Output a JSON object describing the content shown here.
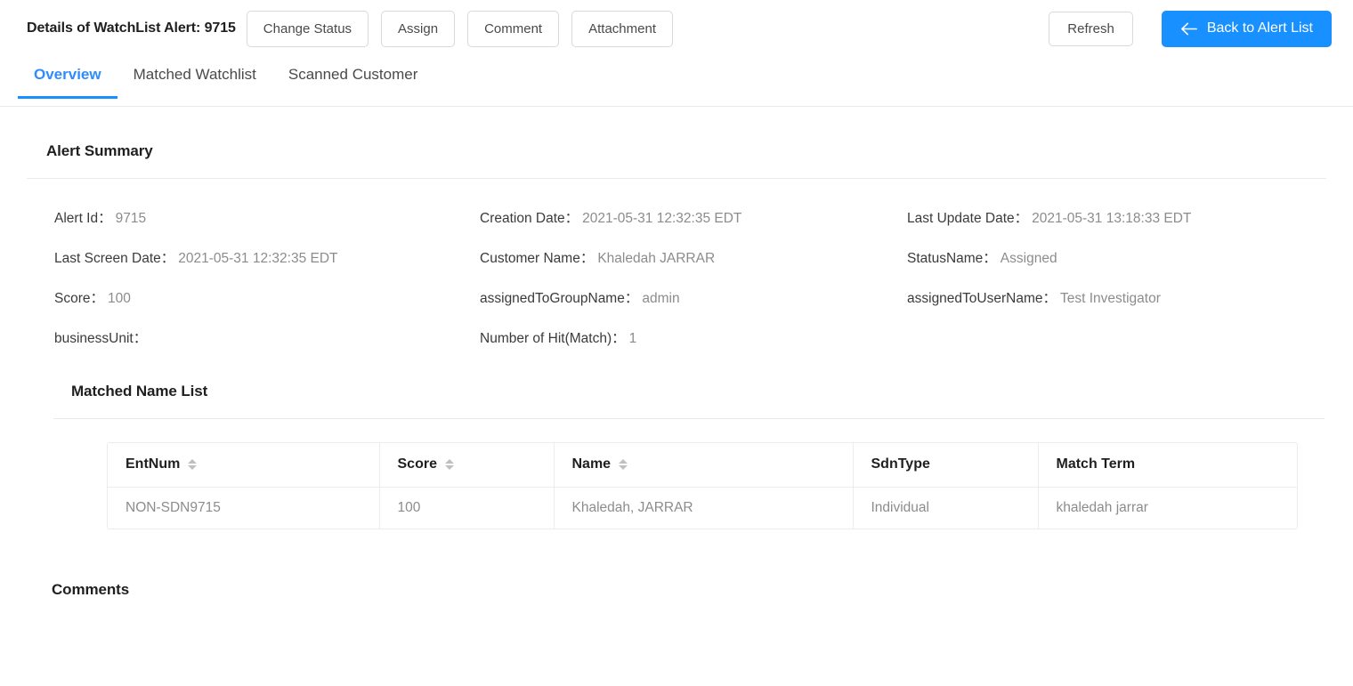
{
  "header": {
    "title": "Details of WatchList Alert: 9715",
    "actions": [
      {
        "name": "change-status-button",
        "label": "Change Status"
      },
      {
        "name": "assign-button",
        "label": "Assign"
      },
      {
        "name": "comment-button",
        "label": "Comment"
      },
      {
        "name": "attachment-button",
        "label": "Attachment"
      }
    ],
    "refresh_label": "Refresh",
    "back_label": "Back to Alert List",
    "back_icon": "arrow-left-icon"
  },
  "tabs": [
    {
      "label": "Overview",
      "active": true
    },
    {
      "label": "Matched Watchlist",
      "active": false
    },
    {
      "label": "Scanned Customer",
      "active": false
    }
  ],
  "alert_summary": {
    "section_title": "Alert Summary",
    "fields": [
      {
        "label": "Alert Id：",
        "value": "9715",
        "name": "field-alert-id"
      },
      {
        "label": "Creation Date：",
        "value": "2021-05-31 12:32:35 EDT",
        "name": "field-creation-date"
      },
      {
        "label": "Last Update Date：",
        "value": "2021-05-31 13:18:33 EDT",
        "name": "field-last-update-date"
      },
      {
        "label": "Last Screen Date：",
        "value": "2021-05-31 12:32:35 EDT",
        "name": "field-last-screen-date"
      },
      {
        "label": "Customer Name：",
        "value": "Khaledah JARRAR",
        "name": "field-customer-name"
      },
      {
        "label": "StatusName：",
        "value": "Assigned",
        "name": "field-status-name"
      },
      {
        "label": "Score：",
        "value": "100",
        "name": "field-score"
      },
      {
        "label": "assignedToGroupName：",
        "value": "admin",
        "name": "field-assigned-to-group-name"
      },
      {
        "label": "assignedToUserName：",
        "value": "Test Investigator",
        "name": "field-assigned-to-user-name"
      },
      {
        "label": "businessUnit：",
        "value": "",
        "name": "field-business-unit"
      },
      {
        "label": "Number of Hit(Match)：",
        "value": "1",
        "name": "field-number-of-hits"
      },
      {
        "label": "",
        "value": "",
        "name": "field-empty"
      }
    ]
  },
  "matched_name_list": {
    "section_title": "Matched Name List",
    "columns": [
      {
        "label": "EntNum",
        "sortable": true,
        "key": "entnum"
      },
      {
        "label": "Score",
        "sortable": true,
        "key": "score"
      },
      {
        "label": "Name",
        "sortable": true,
        "key": "name"
      },
      {
        "label": "SdnType",
        "sortable": false,
        "key": "sdntype"
      },
      {
        "label": "Match Term",
        "sortable": false,
        "key": "matchterm"
      }
    ],
    "rows": [
      {
        "entnum": "NON-SDN9715",
        "score": "100",
        "name": "Khaledah, JARRAR",
        "sdntype": "Individual",
        "matchterm": "khaledah jarrar"
      }
    ]
  },
  "comments": {
    "section_title": "Comments"
  },
  "colors": {
    "primary": "#1890ff",
    "tab_active": "#2f8cff",
    "label_text": "#3b3b3b",
    "value_text": "#8c8c8c",
    "border": "#e8e8e8"
  }
}
